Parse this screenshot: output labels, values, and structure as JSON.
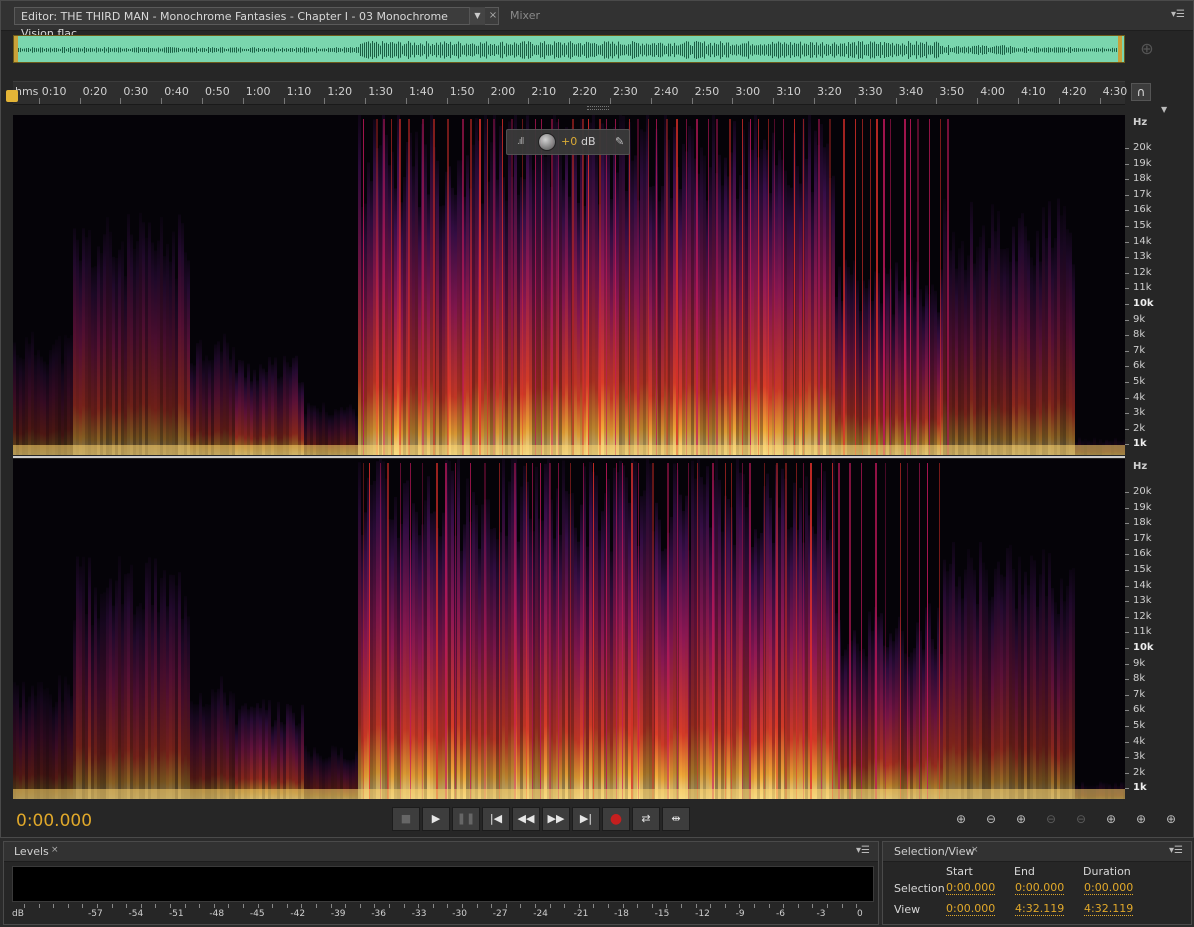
{
  "editor": {
    "tab_title": "Editor: THE THIRD MAN - Monochrome Fantasies - Chapter I - 03 Monochrome Vision.flac",
    "tab_dropdown_glyph": "▼",
    "tab_close_glyph": "×",
    "mixer_tab": "Mixer",
    "panel_menu_glyph": "▾☰"
  },
  "ruler": {
    "unit": "hms",
    "labels": [
      "0:10",
      "0:20",
      "0:30",
      "0:40",
      "0:50",
      "1:00",
      "1:10",
      "1:20",
      "1:30",
      "1:40",
      "1:50",
      "2:00",
      "2:10",
      "2:20",
      "2:30",
      "2:40",
      "2:50",
      "3:00",
      "3:10",
      "3:20",
      "3:30",
      "3:40",
      "3:50",
      "4:00",
      "4:10",
      "4:20",
      "4:30"
    ],
    "total_seconds": 272.119
  },
  "freq_axis": {
    "unit": "Hz",
    "labels": [
      "20k",
      "19k",
      "18k",
      "17k",
      "16k",
      "15k",
      "14k",
      "13k",
      "12k",
      "11k",
      "10k",
      "9k",
      "8k",
      "7k",
      "6k",
      "5k",
      "4k",
      "3k",
      "2k",
      "1k"
    ],
    "bold_labels": [
      "10k",
      "1k"
    ]
  },
  "hud": {
    "value": "+0",
    "unit": "dB"
  },
  "transport": {
    "time": "0:00.000",
    "buttons": [
      "stop-icon",
      "play-icon",
      "pause-icon",
      "move-to-start-icon",
      "rewind-icon",
      "fast-forward-icon",
      "move-to-end-icon",
      "record-icon",
      "loop-icon",
      "skip-selection-icon"
    ]
  },
  "zoom_tools": [
    "zoom-in-amplitude-icon",
    "zoom-out-amplitude-icon",
    "zoom-in-time-icon",
    "zoom-out-time-icon",
    "zoom-out-full-icon",
    "zoom-in-selection-icon",
    "zoom-selection-left-icon",
    "zoom-selection-right-icon"
  ],
  "levels": {
    "tab": "Levels",
    "close_glyph": "×",
    "db_unit": "dB",
    "db_labels": [
      "-57",
      "-54",
      "-51",
      "-48",
      "-45",
      "-42",
      "-39",
      "-36",
      "-33",
      "-30",
      "-27",
      "-24",
      "-21",
      "-18",
      "-15",
      "-12",
      "-9",
      "-6",
      "-3",
      "0"
    ]
  },
  "selection_view": {
    "tab": "Selection/View",
    "close_glyph": "×",
    "col_start": "Start",
    "col_end": "End",
    "col_duration": "Duration",
    "row_selection": "Selection",
    "row_view": "View",
    "selection": {
      "start": "0:00.000",
      "end": "0:00.000",
      "duration": "0:00.000"
    },
    "view": {
      "start": "0:00.000",
      "end": "4:32.119",
      "duration": "4:32.119"
    }
  },
  "colors": {
    "accent": "#e0a82a",
    "overview_wave": "#79d9b1",
    "spectrogram_hot": "#ffd46b",
    "spectrogram_mid": "#e0302a",
    "spectrogram_cool": "#4a1a6e"
  }
}
